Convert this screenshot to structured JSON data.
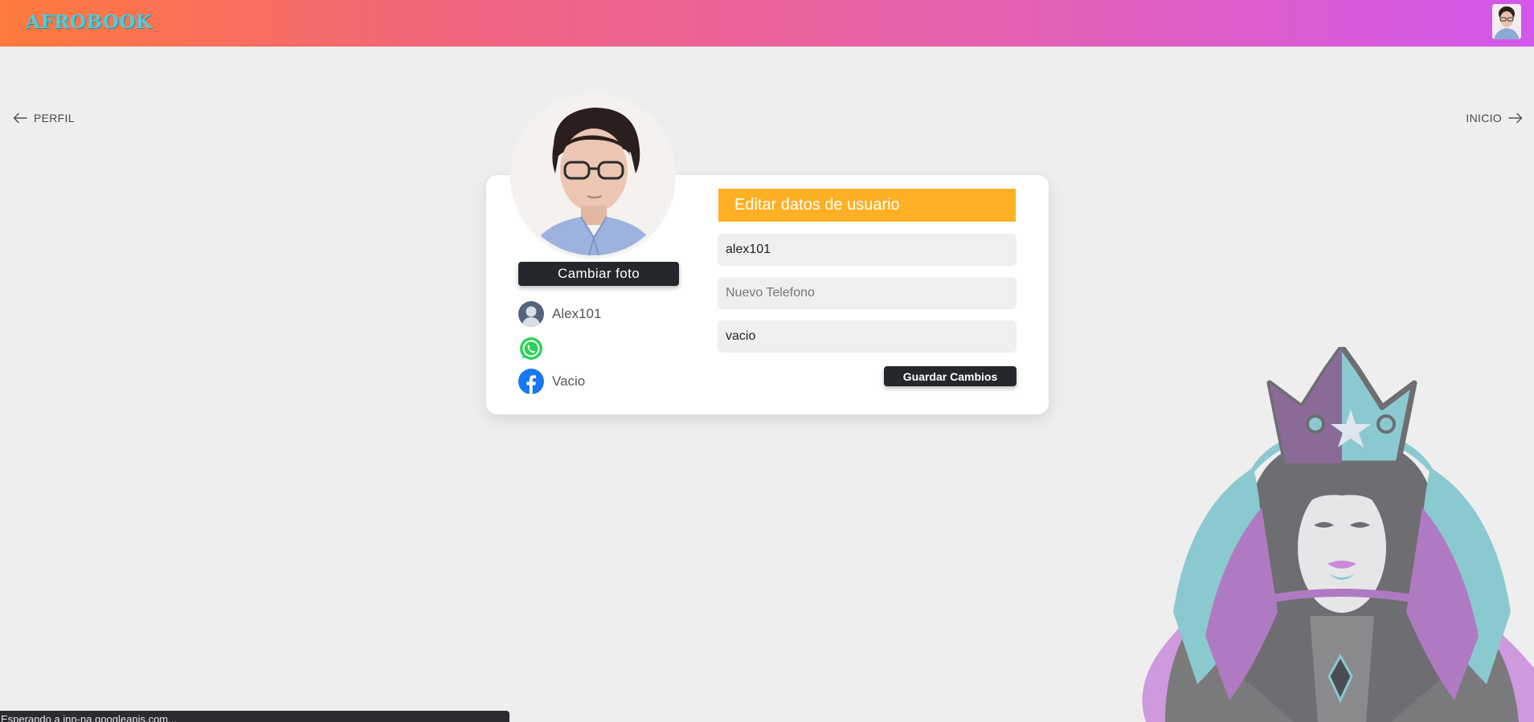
{
  "header": {
    "logo_text": "AFROBOOK"
  },
  "nav": {
    "back_label": "PERFIL",
    "forward_label": "INICIO"
  },
  "profile": {
    "change_photo_label": "Cambiar foto",
    "username": "Alex101",
    "whatsapp": "",
    "facebook": "Vacio"
  },
  "edit": {
    "title": "Editar datos de usuario",
    "username_value": "alex101",
    "phone_value": "",
    "phone_placeholder": "Nuevo Telefono",
    "facebook_value": "vacio",
    "save_label": "Guardar Cambios"
  },
  "status": {
    "text": "Esperando a inn-na.googleapis.com..."
  },
  "colors": {
    "gradient_start": "#ff7a3d",
    "gradient_end": "#d357ec",
    "header_accent": "#fdb024",
    "button_dark": "#24272c",
    "logo": "#55c9d8"
  },
  "icons": {
    "back": "arrow-left-icon",
    "forward": "arrow-right-icon",
    "user": "user-avatar-icon",
    "whatsapp": "whatsapp-icon",
    "facebook": "facebook-icon"
  }
}
